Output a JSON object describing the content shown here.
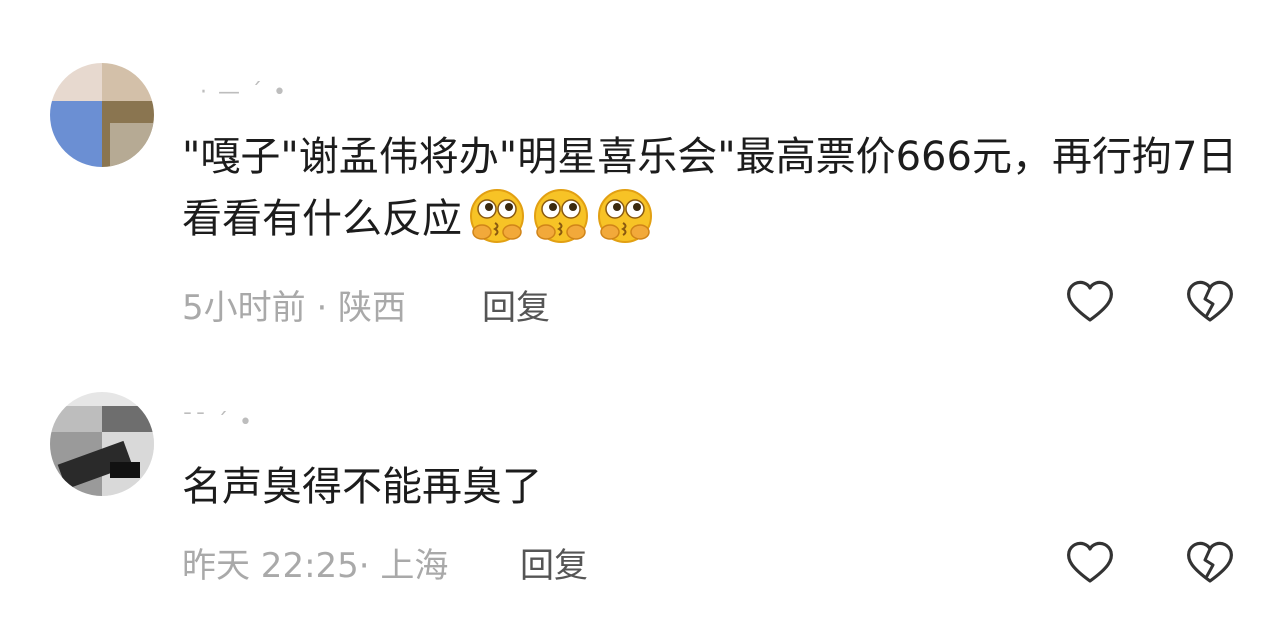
{
  "comments": [
    {
      "username": "  · — ˊ •",
      "text": "\"嘎子\"谢孟伟将办\"明星喜乐会\"最高票价666元，再行拘7日看看有什么反应",
      "emojis": [
        "thinking-kiss-emoji",
        "thinking-kiss-emoji",
        "thinking-kiss-emoji"
      ],
      "time_location": "5小时前 · 陕西",
      "reply_label": "回复"
    },
    {
      "username": "ˉˉ ˊ •",
      "text": "名声臭得不能再臭了",
      "emojis": [],
      "time_location": "昨天 22:25· 上海",
      "reply_label": "回复"
    }
  ],
  "icons": {
    "like": "heart-outline-icon",
    "dislike": "broken-heart-outline-icon"
  },
  "colors": {
    "text": "#1c1c1c",
    "meta": "#a9a9a9",
    "reply": "#555555",
    "icon": "#333333"
  }
}
